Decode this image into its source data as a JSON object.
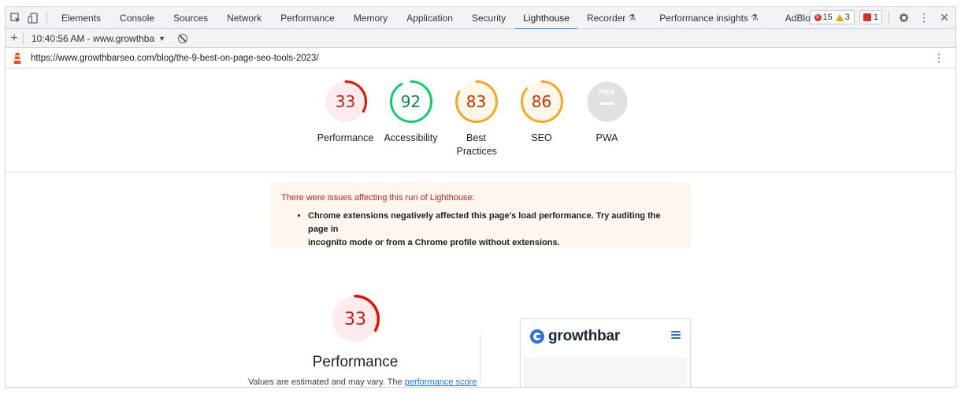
{
  "devtools": {
    "tabs": [
      {
        "label": "Elements"
      },
      {
        "label": "Console"
      },
      {
        "label": "Sources"
      },
      {
        "label": "Network"
      },
      {
        "label": "Performance"
      },
      {
        "label": "Memory"
      },
      {
        "label": "Application"
      },
      {
        "label": "Security"
      },
      {
        "label": "Lighthouse",
        "active": true
      },
      {
        "label": "Recorder",
        "experimental": true
      },
      {
        "label": "Performance insights",
        "experimental": true
      },
      {
        "label": "AdBlock"
      }
    ],
    "counts": {
      "errors": "15",
      "warnings": "3",
      "issues": "1"
    },
    "colors": {
      "error": "#d93025",
      "warning": "#e8a600",
      "active_tab": "#1a73e8"
    }
  },
  "lighthouse_toolbar": {
    "report_selector": "10:40:56 AM - www.growthba"
  },
  "url_bar": {
    "url": "https://www.growthbarseo.com/blog/the-9-best-on-page-seo-tools-2023/"
  },
  "scores": [
    {
      "label": "Performance",
      "value": "33",
      "fraction": 0.33,
      "color": "#eb0f00",
      "bg": "#fdeceb"
    },
    {
      "label": "Accessibility",
      "value": "92",
      "fraction": 0.92,
      "color": "#0cce6b",
      "bg": "#ffffff",
      "text_color": "#088a47"
    },
    {
      "label": "Best Practices",
      "value": "83",
      "fraction": 0.83,
      "color": "#f5a623",
      "bg": "#fff6ea",
      "text_color": "#c33300"
    },
    {
      "label": "SEO",
      "value": "86",
      "fraction": 0.86,
      "color": "#f5a623",
      "bg": "#fff6ea",
      "text_color": "#c33300"
    },
    {
      "label": "PWA",
      "value": "",
      "badge": "PWA",
      "color": "#c7c7c7",
      "bg": "#e1e1e1"
    }
  ],
  "warning": {
    "title": "There were issues affecting this run of Lighthouse:",
    "items": [
      {
        "line1": "Chrome extensions negatively affected this page's load performance. Try auditing the page in",
        "line2": "incognito mode or from a Chrome profile without extensions."
      }
    ]
  },
  "performance_section": {
    "score": "33",
    "fraction": 0.33,
    "title": "Performance",
    "note_prefix": "Values are estimated and may vary. The ",
    "note_link": "performance score"
  },
  "screenshot_thumb": {
    "brand": "growthbar"
  }
}
